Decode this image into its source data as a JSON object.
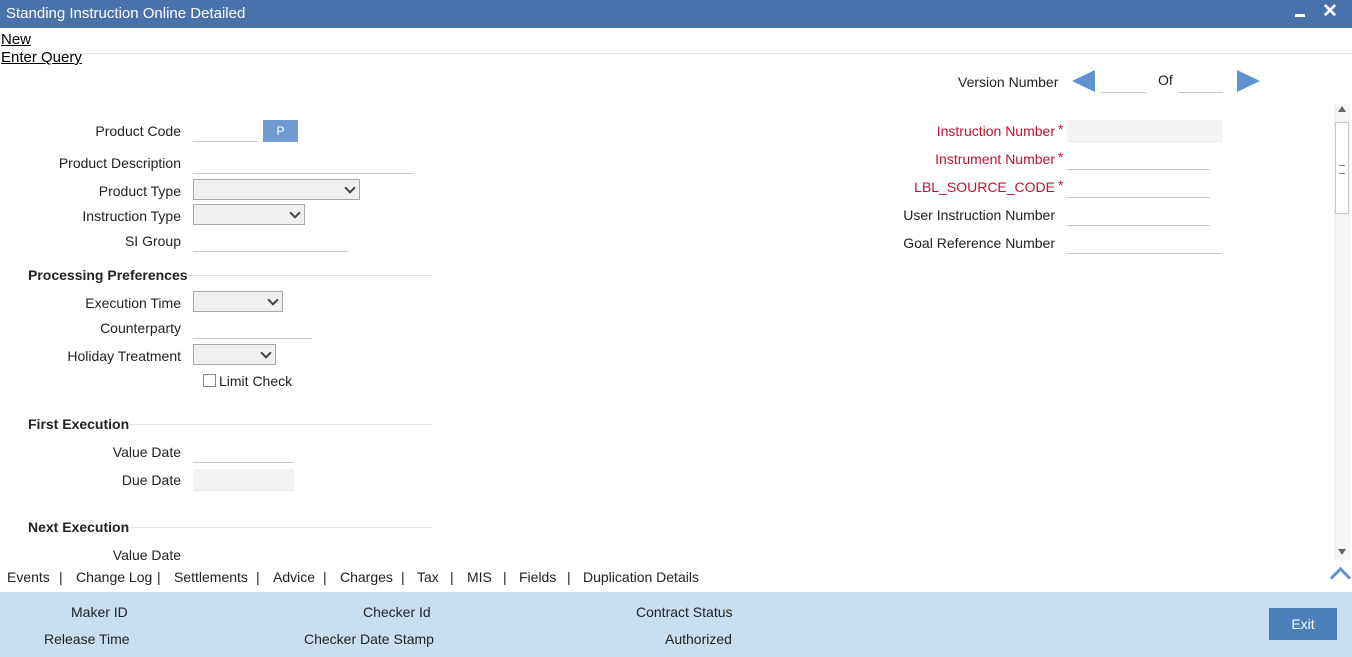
{
  "window": {
    "title": "Standing Instruction Online Detailed",
    "close_glyph": "✕"
  },
  "menu": {
    "new": "New",
    "enter_query": "Enter Query"
  },
  "version": {
    "label": "Version Number",
    "of": "Of"
  },
  "left": {
    "product_code": "Product Code",
    "p_button": "P",
    "product_description": "Product Description",
    "product_type": "Product Type",
    "instruction_type": "Instruction Type",
    "si_group": "SI Group"
  },
  "right": {
    "instruction_number": "Instruction Number",
    "instrument_number": "Instrument Number",
    "source_code": "LBL_SOURCE_CODE",
    "required_mark": "*",
    "user_instruction_number": "User Instruction Number",
    "goal_reference_number": "Goal Reference Number"
  },
  "processing": {
    "title": "Processing Preferences",
    "execution_time": "Execution Time",
    "counterparty": "Counterparty",
    "holiday_treatment": "Holiday Treatment",
    "limit_check": "Limit Check"
  },
  "first_execution": {
    "title": "First Execution",
    "value_date": "Value Date",
    "due_date": "Due Date"
  },
  "next_execution": {
    "title": "Next Execution",
    "value_date": "Value Date"
  },
  "tabs": [
    "Events",
    "Change Log",
    "Settlements",
    "Advice",
    "Charges",
    "Tax",
    "MIS",
    "Fields",
    "Duplication Details"
  ],
  "tab_separator": "|",
  "footer": {
    "maker_id": "Maker ID",
    "release_time": "Release Time",
    "checker_id": "Checker Id",
    "checker_date_stamp": "Checker Date Stamp",
    "contract_status": "Contract Status",
    "authorized": "Authorized",
    "exit": "Exit"
  }
}
